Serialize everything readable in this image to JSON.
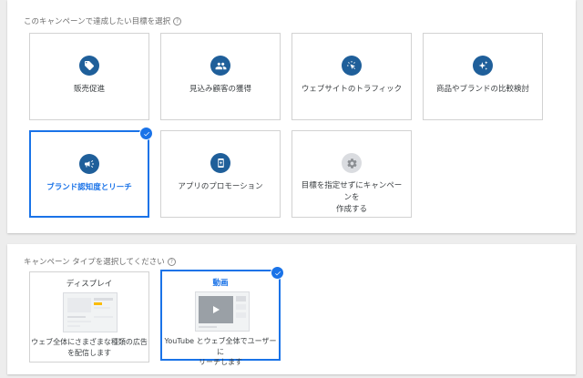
{
  "objectives": {
    "title": "このキャンペーンで達成したい目標を選択",
    "help_glyph": "?",
    "cards": [
      {
        "label": "販売促進",
        "icon": "tag-icon"
      },
      {
        "label": "見込み顧客の獲得",
        "icon": "people-icon"
      },
      {
        "label": "ウェブサイトのトラフィック",
        "icon": "cursor-click-icon"
      },
      {
        "label": "商品やブランドの比較検討",
        "icon": "sparkle-icon"
      },
      {
        "label": "ブランド認知度とリーチ",
        "icon": "megaphone-icon",
        "selected": true
      },
      {
        "label": "アプリのプロモーション",
        "icon": "phone-app-icon"
      },
      {
        "label_line1": "目標を指定せずにキャンペーンを",
        "label_line2": "作成する",
        "icon": "gear-icon"
      }
    ]
  },
  "campaign_types": {
    "title": "キャンペーン タイプを選択してください",
    "help_glyph": "?",
    "cards": [
      {
        "title": "ディスプレイ",
        "desc_line1": "ウェブ全体にさまざまな種類の広告",
        "desc_line2": "を配信します",
        "icon": "display-ad-thumbnail-icon"
      },
      {
        "title": "動画",
        "desc_line1": "YouTube とウェブ全体でユーザーに",
        "desc_line2": "リーチします",
        "icon": "video-thumbnail-icon",
        "selected": true
      }
    ]
  },
  "colors": {
    "accent": "#1a73e8",
    "icon_circle": "#1f5f9a",
    "icon_circle_neutral": "#dadce0",
    "background": "#ededed"
  }
}
